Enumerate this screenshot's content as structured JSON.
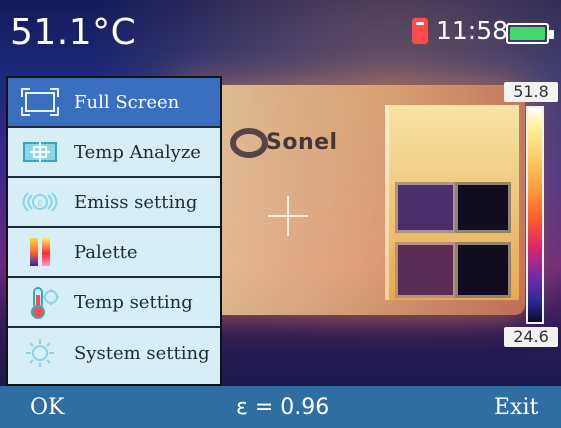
{
  "status": {
    "temperature": "51.1°C",
    "time": "11:58",
    "battery_level": 1.0,
    "colors": {
      "battery_fill": "#42d86b",
      "sd_icon": "#ff4b4b"
    }
  },
  "logo": {
    "text": "Sonel"
  },
  "menu": {
    "selected_index": 0,
    "items": [
      {
        "label": "Full Screen",
        "icon": "fullscreen-icon"
      },
      {
        "label": "Temp Analyze",
        "icon": "temp-analyze-icon"
      },
      {
        "label": "Emiss setting",
        "icon": "emissivity-icon"
      },
      {
        "label": "Palette",
        "icon": "palette-icon"
      },
      {
        "label": "Temp setting",
        "icon": "temp-setting-icon"
      },
      {
        "label": "System setting",
        "icon": "system-setting-icon"
      }
    ]
  },
  "scale": {
    "max": "51.8",
    "min": "24.6"
  },
  "bottom": {
    "ok": "OK",
    "emissivity": "ε = 0.96",
    "exit": "Exit"
  }
}
